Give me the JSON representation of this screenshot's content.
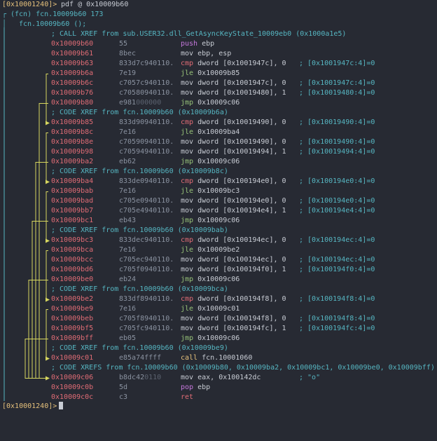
{
  "prompt_cmd": {
    "addr": "[0x10001240]>",
    "cmd": " pdf @ 0x10009b60"
  },
  "fn_header": {
    "line1": "(fcn) fcn.10009b60 173",
    "line2": "fcn.10009b60 ();"
  },
  "lines": [
    {
      "kind": "comment",
      "text": "; CALL XREF from sub.USER32.dll_GetAsyncKeyState_10009eb0 (0x1000a1e5)"
    },
    {
      "kind": "insn",
      "addr": "0x10009b60",
      "bytes": "55",
      "mnem": "push",
      "ops": "ebp",
      "cmt": ""
    },
    {
      "kind": "insn",
      "addr": "0x10009b61",
      "bytes": "8bec",
      "mnem": "mov",
      "ops": "ebp, esp",
      "cmt": ""
    },
    {
      "kind": "insn",
      "addr": "0x10009b63",
      "bytes": "833d7c940110.",
      "mnem": "cmp",
      "ops": "dword [0x1001947c], 0",
      "cmt": "; [0x1001947c:4]=0"
    },
    {
      "kind": "insn",
      "addr": "0x10009b6a",
      "bytes": "7e19",
      "mnem": "jle",
      "ops": "0x10009b85",
      "cmt": ""
    },
    {
      "kind": "insn",
      "addr": "0x10009b6c",
      "bytes": "c7057c940110.",
      "mnem": "mov",
      "ops": "dword [0x1001947c], 0",
      "cmt": "; [0x1001947c:4]=0"
    },
    {
      "kind": "insn",
      "addr": "0x10009b76",
      "bytes": "c70580940110.",
      "mnem": "mov",
      "ops": "dword [0x10019480], 1",
      "cmt": "; [0x10019480:4]=0"
    },
    {
      "kind": "insn",
      "addr": "0x10009b80",
      "bytes": "e981",
      "bytes_dim": "000000",
      "mnem": "jmp",
      "ops": "0x10009c06",
      "cmt": ""
    },
    {
      "kind": "comment",
      "text": "; CODE XREF from fcn.10009b60 (0x10009b6a)"
    },
    {
      "kind": "insn",
      "addr": "0x10009b85",
      "bytes": "833d90940110.",
      "mnem": "cmp",
      "ops": "dword [0x10019490], 0",
      "cmt": "; [0x10019490:4]=0"
    },
    {
      "kind": "insn",
      "addr": "0x10009b8c",
      "bytes": "7e16",
      "mnem": "jle",
      "ops": "0x10009ba4",
      "cmt": ""
    },
    {
      "kind": "insn",
      "addr": "0x10009b8e",
      "bytes": "c70590940110.",
      "mnem": "mov",
      "ops": "dword [0x10019490], 0",
      "cmt": "; [0x10019490:4]=0"
    },
    {
      "kind": "insn",
      "addr": "0x10009b98",
      "bytes": "c70594940110.",
      "mnem": "mov",
      "ops": "dword [0x10019494], 1",
      "cmt": "; [0x10019494:4]=0"
    },
    {
      "kind": "insn",
      "addr": "0x10009ba2",
      "bytes": "eb62",
      "mnem": "jmp",
      "ops": "0x10009c06",
      "cmt": ""
    },
    {
      "kind": "comment",
      "text": "; CODE XREF from fcn.10009b60 (0x10009b8c)"
    },
    {
      "kind": "insn",
      "addr": "0x10009ba4",
      "bytes": "833de0940110.",
      "mnem": "cmp",
      "ops": "dword [0x100194e0], 0",
      "cmt": "; [0x100194e0:4]=0"
    },
    {
      "kind": "insn",
      "addr": "0x10009bab",
      "bytes": "7e16",
      "mnem": "jle",
      "ops": "0x10009bc3",
      "cmt": ""
    },
    {
      "kind": "insn",
      "addr": "0x10009bad",
      "bytes": "c705e0940110.",
      "mnem": "mov",
      "ops": "dword [0x100194e0], 0",
      "cmt": "; [0x100194e0:4]=0"
    },
    {
      "kind": "insn",
      "addr": "0x10009bb7",
      "bytes": "c705e4940110.",
      "mnem": "mov",
      "ops": "dword [0x100194e4], 1",
      "cmt": "; [0x100194e4:4]=0"
    },
    {
      "kind": "insn",
      "addr": "0x10009bc1",
      "bytes": "eb43",
      "mnem": "jmp",
      "ops": "0x10009c06",
      "cmt": ""
    },
    {
      "kind": "comment",
      "text": "; CODE XREF from fcn.10009b60 (0x10009bab)"
    },
    {
      "kind": "insn",
      "addr": "0x10009bc3",
      "bytes": "833dec940110.",
      "mnem": "cmp",
      "ops": "dword [0x100194ec], 0",
      "cmt": "; [0x100194ec:4]=0"
    },
    {
      "kind": "insn",
      "addr": "0x10009bca",
      "bytes": "7e16",
      "mnem": "jle",
      "ops": "0x10009be2",
      "cmt": ""
    },
    {
      "kind": "insn",
      "addr": "0x10009bcc",
      "bytes": "c705ec940110.",
      "mnem": "mov",
      "ops": "dword [0x100194ec], 0",
      "cmt": "; [0x100194ec:4]=0"
    },
    {
      "kind": "insn",
      "addr": "0x10009bd6",
      "bytes": "c705f0940110.",
      "mnem": "mov",
      "ops": "dword [0x100194f0], 1",
      "cmt": "; [0x100194f0:4]=0"
    },
    {
      "kind": "insn",
      "addr": "0x10009be0",
      "bytes": "eb24",
      "mnem": "jmp",
      "ops": "0x10009c06",
      "cmt": ""
    },
    {
      "kind": "comment",
      "text": "; CODE XREF from fcn.10009b60 (0x10009bca)"
    },
    {
      "kind": "insn",
      "addr": "0x10009be2",
      "bytes": "833df8940110.",
      "mnem": "cmp",
      "ops": "dword [0x100194f8], 0",
      "cmt": "; [0x100194f8:4]=0"
    },
    {
      "kind": "insn",
      "addr": "0x10009be9",
      "bytes": "7e16",
      "mnem": "jle",
      "ops": "0x10009c01",
      "cmt": ""
    },
    {
      "kind": "insn",
      "addr": "0x10009beb",
      "bytes": "c705f8940110.",
      "mnem": "mov",
      "ops": "dword [0x100194f8], 0",
      "cmt": "; [0x100194f8:4]=0"
    },
    {
      "kind": "insn",
      "addr": "0x10009bf5",
      "bytes": "c705fc940110.",
      "mnem": "mov",
      "ops": "dword [0x100194fc], 1",
      "cmt": "; [0x100194fc:4]=0"
    },
    {
      "kind": "insn",
      "addr": "0x10009bff",
      "bytes": "eb05",
      "mnem": "jmp",
      "ops": "0x10009c06",
      "cmt": ""
    },
    {
      "kind": "comment",
      "text": "; CODE XREF from fcn.10009b60 (0x10009be9)"
    },
    {
      "kind": "insn",
      "addr": "0x10009c01",
      "bytes": "e85a74ffff",
      "mnem": "call",
      "ops": "fcn.10001060",
      "cmt": ""
    },
    {
      "kind": "comment",
      "text": "; CODE XREFS from fcn.10009b60 (0x10009b80, 0x10009ba2, 0x10009bc1, 0x10009be0, 0x10009bff)"
    },
    {
      "kind": "insn",
      "addr": "0x10009c06",
      "bytes": "b8dc42",
      "bytes_dim": "0110",
      "mnem": "mov",
      "ops": "eax, 0x100142dc",
      "cmt": "; \"o\""
    },
    {
      "kind": "insn",
      "addr": "0x10009c0b",
      "bytes": "5d",
      "mnem": "pop",
      "ops": "ebp",
      "cmt": ""
    },
    {
      "kind": "insn",
      "addr": "0x10009c0c",
      "bytes": "c3",
      "mnem": "ret",
      "ops": "",
      "cmt": ""
    }
  ],
  "end_prompt": "[0x10001240]>",
  "colors": {
    "background": "#272a33",
    "arrow": "#d7d75f",
    "address": "#e06c75",
    "comment": "#56b6c2",
    "prompt": "#e5c07b"
  }
}
